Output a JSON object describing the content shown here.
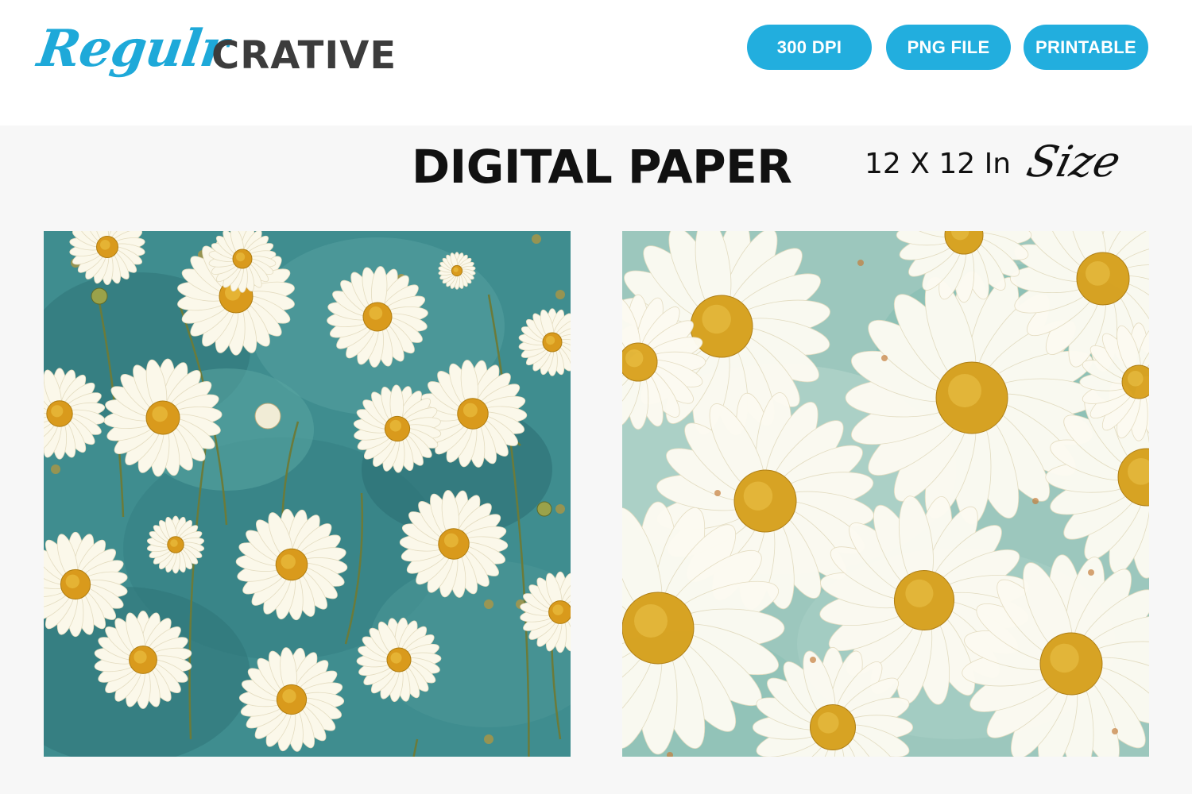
{
  "brand": {
    "script_part": "Regulr",
    "block_part": "CRATIVE"
  },
  "badges": [
    {
      "label": "300 DPI"
    },
    {
      "label": "PNG FILE"
    },
    {
      "label": "PRINTABLE"
    }
  ],
  "title": "DIGITAL PAPER",
  "size_label": {
    "text": "12 X 12 In",
    "script": "Size"
  },
  "colors": {
    "accent": "#22aede",
    "logo_script": "#1ea9d9",
    "logo_block": "#3c3c3c",
    "panel1_bg": "#3f8d8f",
    "panel2_bg": "#9cc7bd",
    "daisy_petal": "#fbf8ea",
    "daisy_center": "#d9a21f"
  },
  "panels": [
    {
      "pattern": "vintage-daisies-teal-grunge"
    },
    {
      "pattern": "painted-daisies-sage"
    }
  ]
}
